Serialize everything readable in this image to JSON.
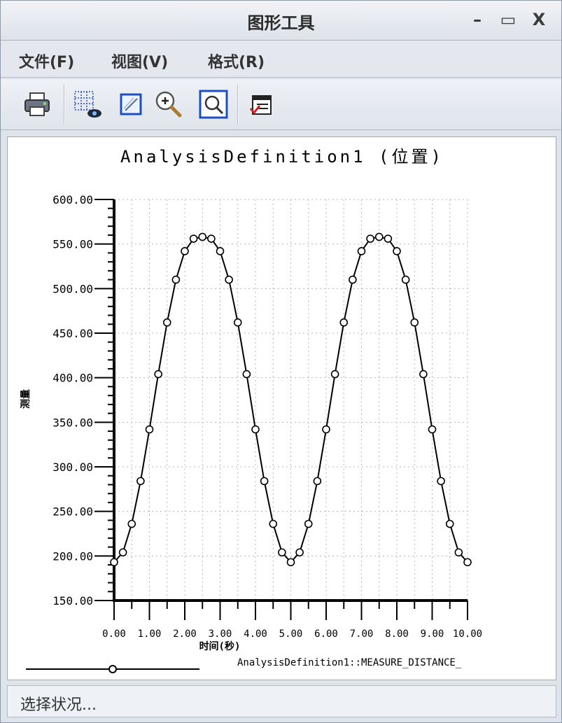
{
  "window": {
    "title": "图形工具",
    "minimize": "–",
    "maximize": "▭",
    "close": "X"
  },
  "menu": [
    {
      "label": "文件(F)"
    },
    {
      "label": "视图(V)"
    },
    {
      "label": "格式(R)"
    }
  ],
  "toolbar": [
    {
      "icon": "printer-icon"
    },
    {
      "icon": "grid-view-icon"
    },
    {
      "icon": "edit-format-icon"
    },
    {
      "icon": "zoom-in-icon"
    },
    {
      "icon": "zoom-fit-icon"
    },
    {
      "icon": "export-table-icon"
    }
  ],
  "status": {
    "text": "选择状况..."
  },
  "chart_data": {
    "type": "line",
    "title": "AnalysisDefinition1 (位置)",
    "xlabel": "时间(秒)",
    "ylabel": "测量",
    "xlim": [
      0,
      10
    ],
    "ylim": [
      150,
      600
    ],
    "x_ticks": [
      "0.00",
      "1.00",
      "2.00",
      "3.00",
      "4.00",
      "5.00",
      "6.00",
      "7.00",
      "8.00",
      "9.00",
      "10.00"
    ],
    "y_ticks": [
      "150.00",
      "200.00",
      "250.00",
      "300.00",
      "350.00",
      "400.00",
      "450.00",
      "500.00",
      "550.00",
      "600.00"
    ],
    "grid": true,
    "markers": "circle",
    "series": [
      {
        "name": "AnalysisDefinition1::MEASURE_DISTANCE_",
        "color": "#000000",
        "x": [
          0,
          0.25,
          0.5,
          0.75,
          1,
          1.25,
          1.5,
          1.75,
          2,
          2.25,
          2.5,
          2.75,
          3,
          3.25,
          3.5,
          3.75,
          4,
          4.25,
          4.5,
          4.75,
          5,
          5.25,
          5.5,
          5.75,
          6,
          6.25,
          6.5,
          6.75,
          7,
          7.25,
          7.5,
          7.75,
          8,
          8.25,
          8.5,
          8.75,
          9,
          9.25,
          9.5,
          9.75,
          10
        ],
        "y": [
          193,
          204,
          236,
          284,
          342,
          404,
          462,
          510,
          542,
          556,
          558,
          556,
          542,
          510,
          462,
          404,
          342,
          284,
          236,
          204,
          193,
          204,
          236,
          284,
          342,
          404,
          462,
          510,
          542,
          556,
          558,
          556,
          542,
          510,
          462,
          404,
          342,
          284,
          236,
          204,
          193
        ]
      }
    ]
  }
}
